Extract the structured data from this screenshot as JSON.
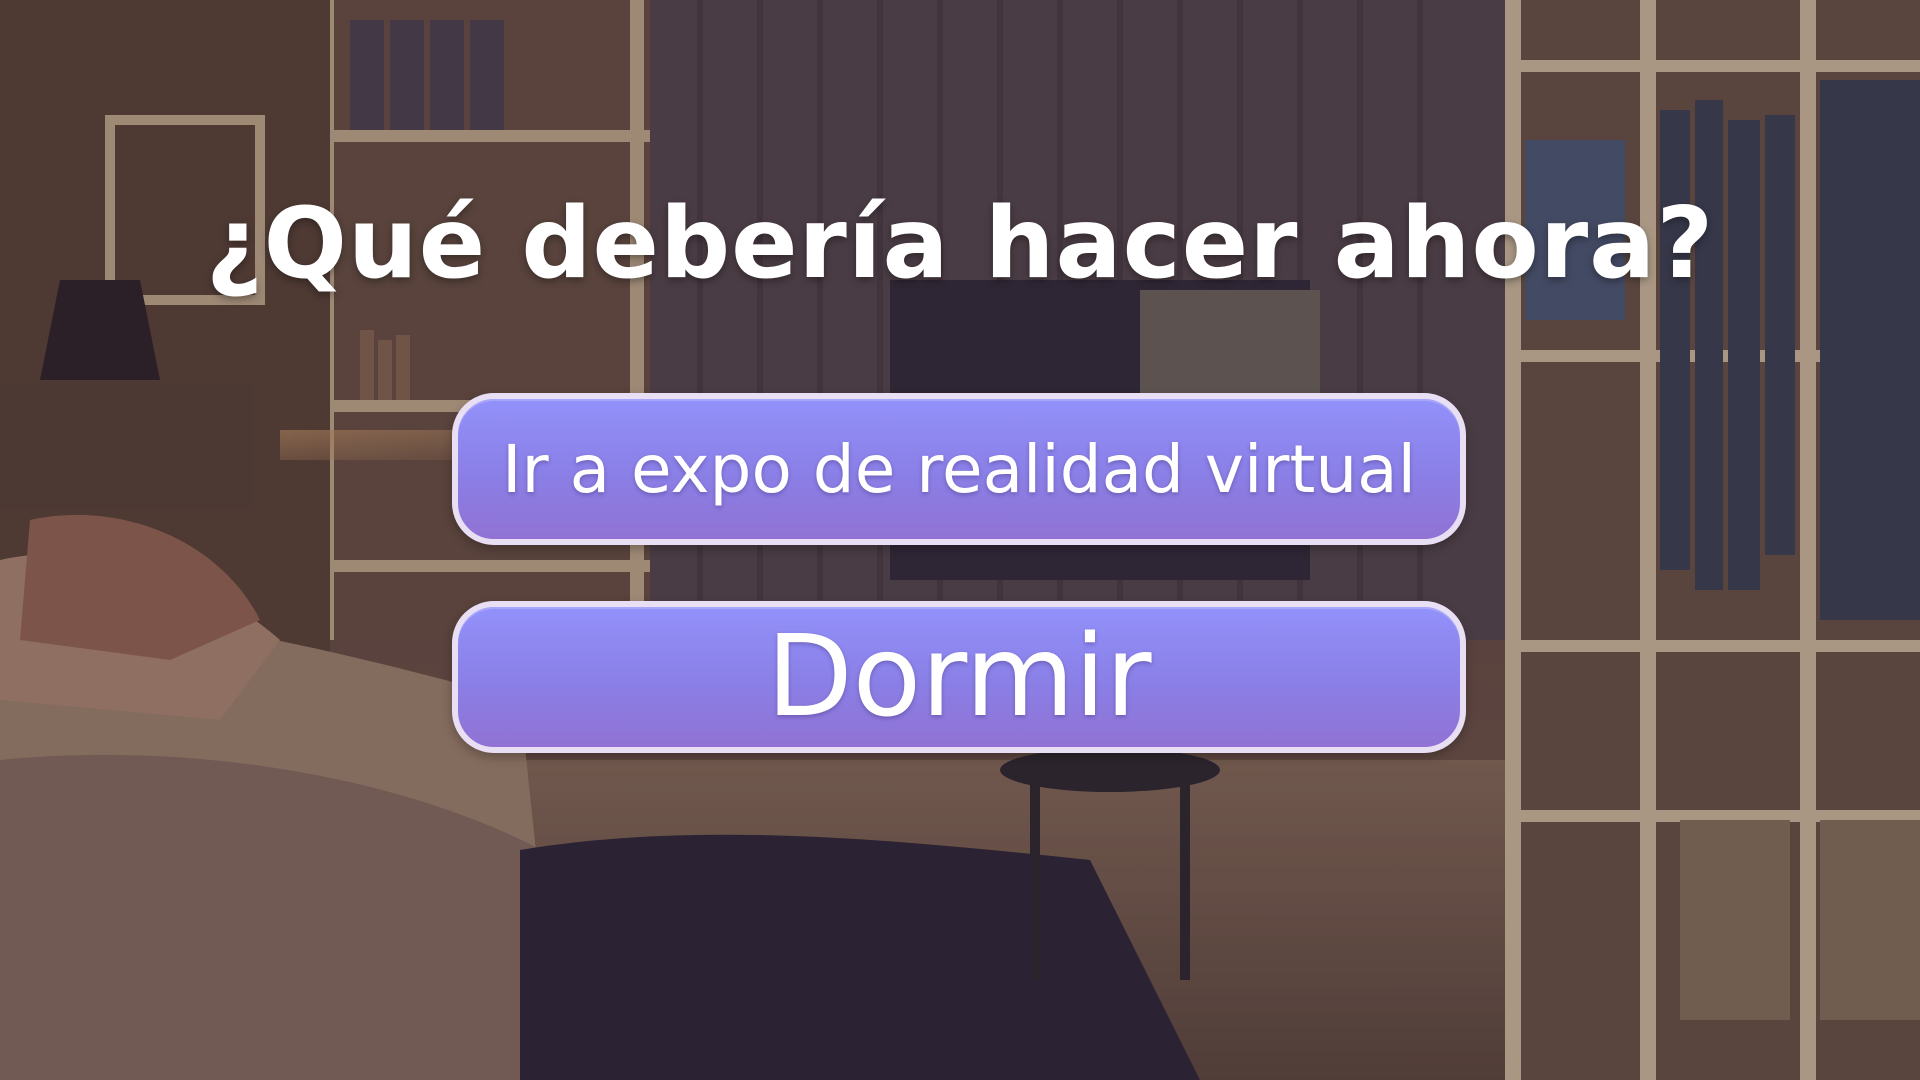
{
  "dialog": {
    "question": "¿Qué debería hacer ahora?",
    "choices": [
      {
        "label": "Ir a expo de realidad virtual"
      },
      {
        "label": "Dormir"
      }
    ]
  },
  "colors": {
    "button_fill_top": "#9291fa",
    "button_fill_bottom": "#9172d4",
    "button_border": "#e9dff5",
    "text": "#ffffff"
  },
  "scene": {
    "background": "bedroom-interior-illustration"
  }
}
